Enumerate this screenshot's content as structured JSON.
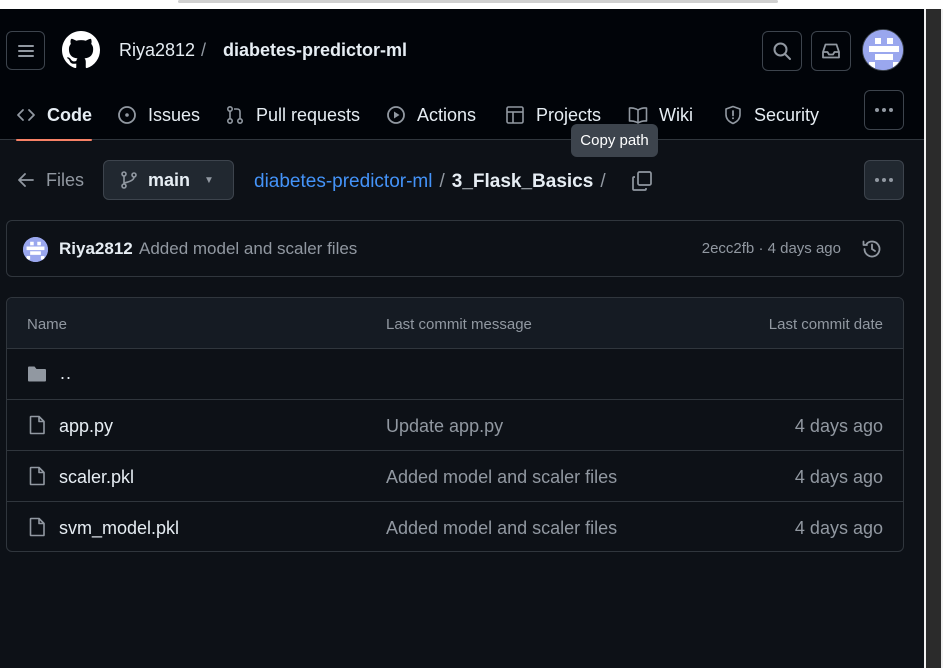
{
  "header": {
    "owner": "Riya2812",
    "separator": "/",
    "repo": "diabetes-predictor-ml"
  },
  "tabs": [
    {
      "label": "Code",
      "icon": "code-icon"
    },
    {
      "label": "Issues",
      "icon": "issue-icon"
    },
    {
      "label": "Pull requests",
      "icon": "pull-request-icon"
    },
    {
      "label": "Actions",
      "icon": "play-icon"
    },
    {
      "label": "Projects",
      "icon": "table-icon"
    },
    {
      "label": "Wiki",
      "icon": "book-icon"
    },
    {
      "label": "Security",
      "icon": "shield-icon"
    }
  ],
  "tooltip": "Copy path",
  "path_bar": {
    "files_label": "Files",
    "branch": "main",
    "repo_crumb": "diabetes-predictor-ml",
    "sep": "/",
    "dir_crumb": "3_Flask_Basics",
    "trailing_sep": "/"
  },
  "commit": {
    "author": "Riya2812",
    "message": "Added model and scaler files",
    "meta": "2ecc2fb · 4 days ago"
  },
  "table": {
    "headers": {
      "name": "Name",
      "message": "Last commit message",
      "date": "Last commit date"
    },
    "parent": "..",
    "rows": [
      {
        "name": "app.py",
        "message": "Update app.py",
        "date": "4 days ago"
      },
      {
        "name": "scaler.pkl",
        "message": "Added model and scaler files",
        "date": "4 days ago"
      },
      {
        "name": "svm_model.pkl",
        "message": "Added model and scaler files",
        "date": "4 days ago"
      }
    ]
  },
  "colors": {
    "background": "#0d1117",
    "header": "#010409",
    "link": "#4493f8",
    "active_tab": "#f78166",
    "muted": "#9198a1"
  }
}
